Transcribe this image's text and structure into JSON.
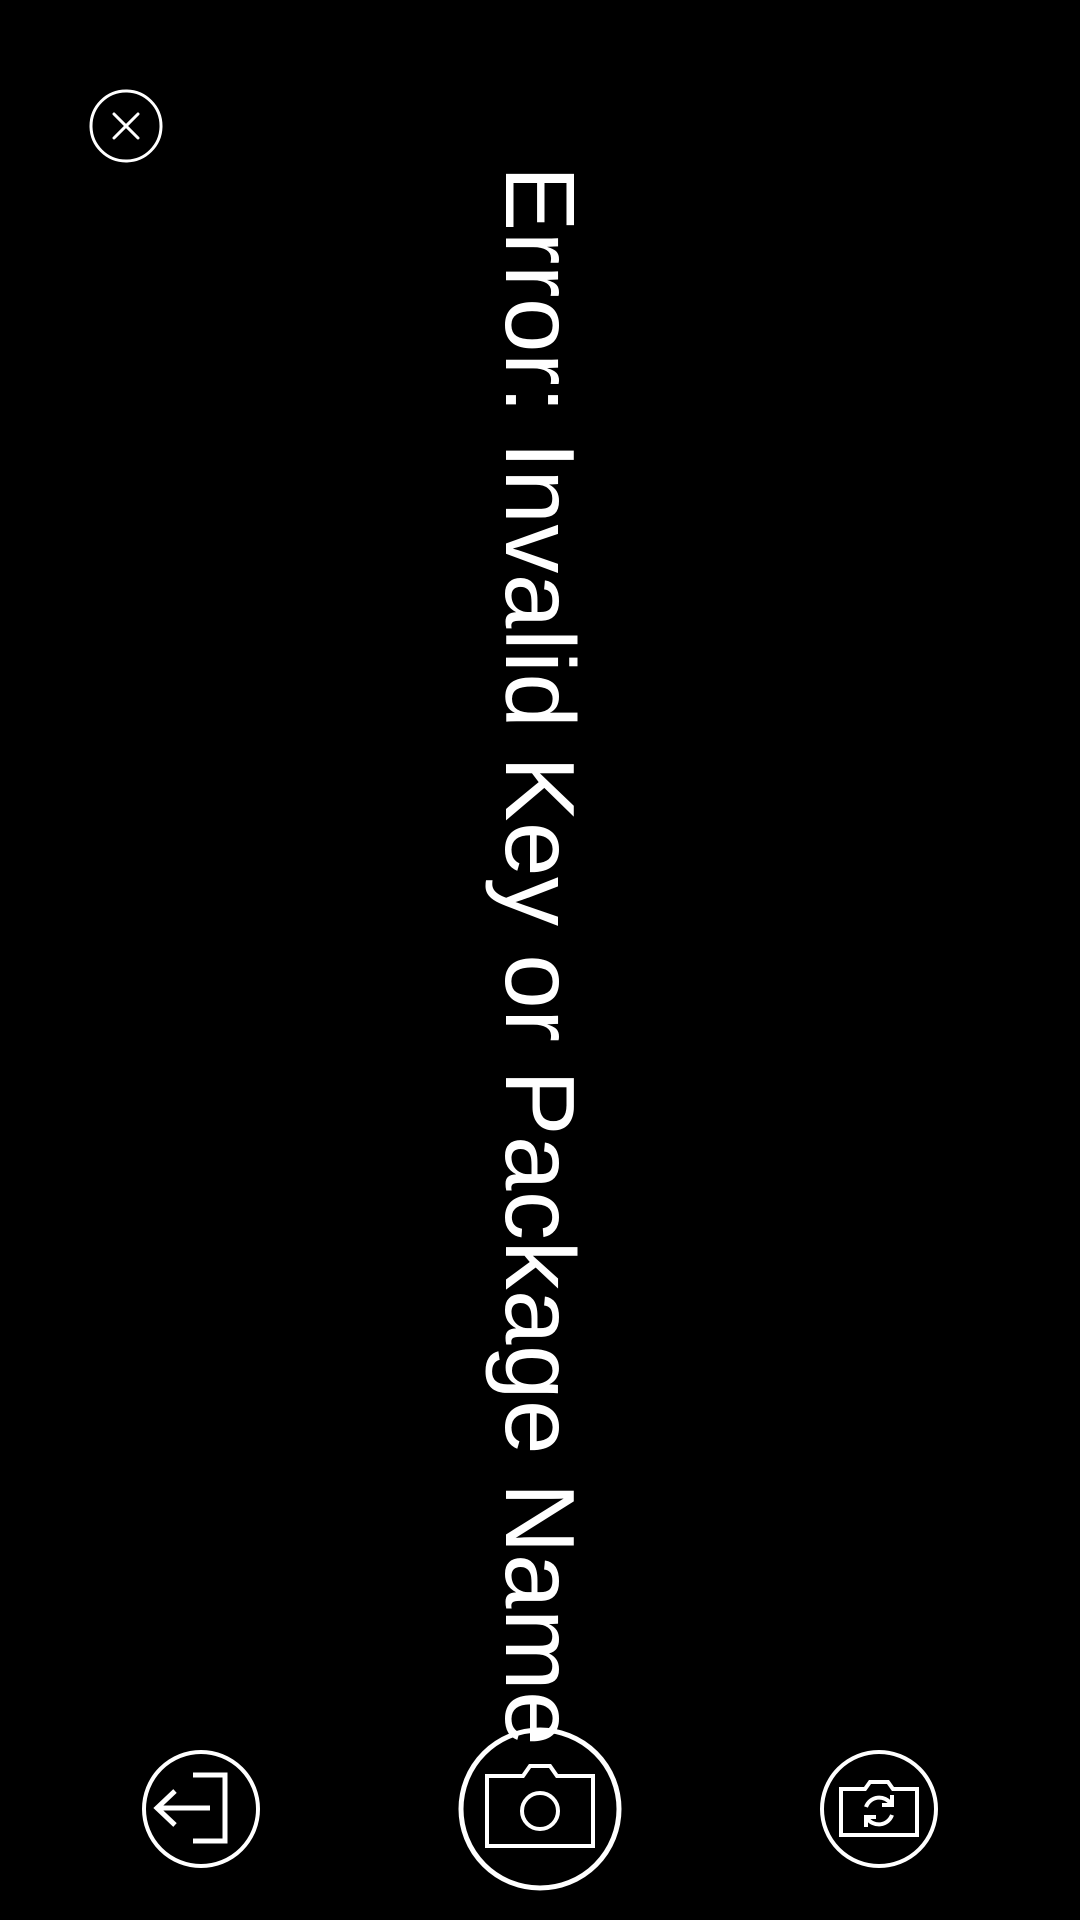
{
  "error": {
    "message": "Error: Invalid Key or Package Name"
  },
  "icons": {
    "close": "close-icon",
    "exit": "exit-icon",
    "capture": "camera-icon",
    "switch_camera": "switch-camera-icon"
  },
  "colors": {
    "background": "#000000",
    "foreground": "#ffffff"
  }
}
